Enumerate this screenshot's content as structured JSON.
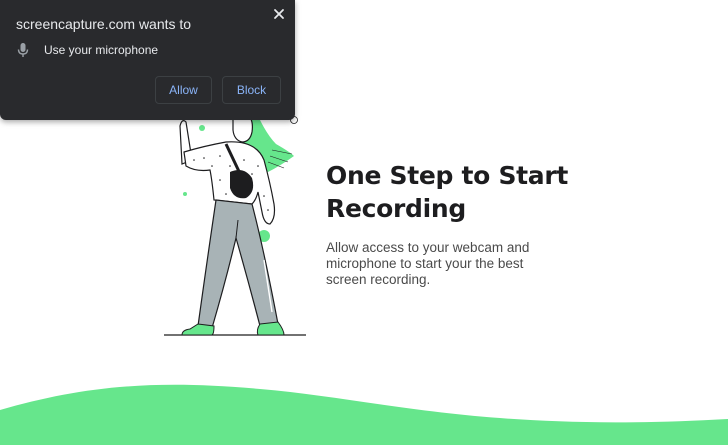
{
  "permission_prompt": {
    "title": "screencapture.com wants to",
    "request_label": "Use your microphone",
    "allow_label": "Allow",
    "block_label": "Block",
    "icons": {
      "close": "close-icon",
      "request": "microphone-icon"
    }
  },
  "main": {
    "headline": "One Step to Start Recording",
    "description": "Allow access to your webcam and microphone to start your the best screen recording."
  },
  "colors": {
    "accent_green": "#66e68c",
    "popup_bg": "#292a2d",
    "popup_button_text": "#8ab4f8",
    "headline_text": "#1d1d1f"
  }
}
